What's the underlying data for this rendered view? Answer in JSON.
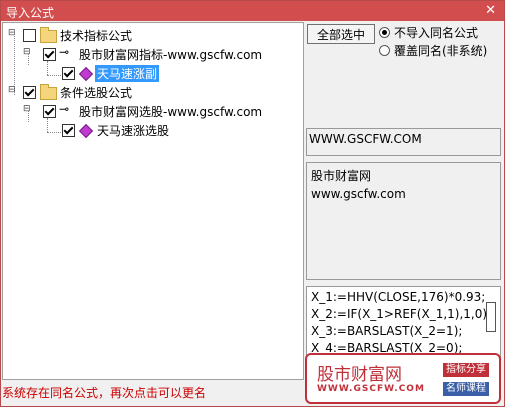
{
  "window": {
    "title": "导入公式",
    "close_glyph": "✕"
  },
  "tree": {
    "nodes": [
      {
        "label": "技术指标公式",
        "checked": false
      },
      {
        "label": "股市财富网指标-www.gscfw.com",
        "checked": true
      },
      {
        "label": "天马速涨副",
        "checked": true,
        "selected": true
      },
      {
        "label": "条件选股公式",
        "checked": true
      },
      {
        "label": "股市财富网选股-www.gscfw.com",
        "checked": true
      },
      {
        "label": "天马速涨选股",
        "checked": true
      }
    ]
  },
  "controls": {
    "select_all": "全部选中",
    "radio_no_import": "不导入同名公式",
    "radio_overwrite": "覆盖同名(非系统)"
  },
  "info": {
    "url": "WWW.GSCFW.COM",
    "desc_line1": "股市财富网",
    "desc_line2": "www.gscfw.com"
  },
  "code": {
    "lines": [
      "X_1:=HHV(CLOSE,176)*0.93;",
      "X_2:=IF(X_1>REF(X_1,1),1,0);",
      "X_3:=BARSLAST(X_2=1);",
      "X_4:=BARSLAST(X_2=0);"
    ]
  },
  "status": "系统存在同名公式，再次点击可以更名",
  "watermark": {
    "brand": "股市财富网",
    "url": "WWW.GSCFW.COM",
    "tag1": "指标分享",
    "tag2": "名师课程"
  },
  "colors": {
    "title_bar": "#d24e4e",
    "selection": "#3399ff",
    "status_text": "#cc0000",
    "brand_red": "#c0303a"
  }
}
